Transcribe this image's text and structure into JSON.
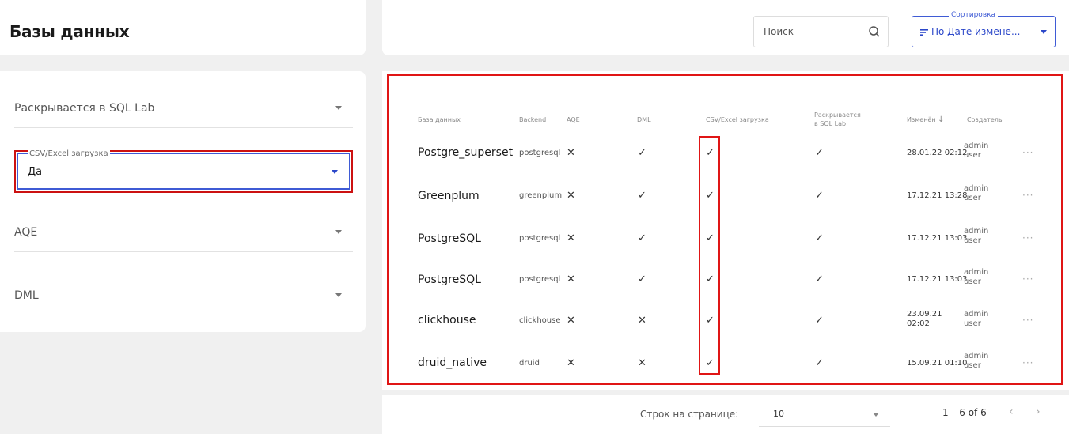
{
  "page": {
    "title": "Базы данных"
  },
  "filters": [
    {
      "label": "Раскрывается в SQL Lab"
    },
    {
      "label": "AQE"
    },
    {
      "label": "DML"
    }
  ],
  "active_filter": {
    "label": "CSV/Excel загрузка",
    "value": "Да"
  },
  "search": {
    "placeholder": "Поиск"
  },
  "sort": {
    "label": "Сортировка",
    "value": "По Дате измене..."
  },
  "table": {
    "headers": {
      "database": "База данных",
      "backend": "Backend",
      "aqe": "AQE",
      "dml": "DML",
      "csv": "CSV/Excel загрузка",
      "exposed": "Раскрывается в SQL Lab",
      "modified": "Изменён",
      "creator": "Создатель"
    },
    "rows": [
      {
        "name": "Postgre_superset",
        "backend": "postgresql",
        "aqe": "✕",
        "dml": "✓",
        "csv": "✓",
        "exposed": "✓",
        "modified": "28.01.22 02:12",
        "creator": "admin user"
      },
      {
        "name": "Greenplum",
        "backend": "greenplum",
        "aqe": "✕",
        "dml": "✓",
        "csv": "✓",
        "exposed": "✓",
        "modified": "17.12.21 13:28",
        "creator": "admin user"
      },
      {
        "name": "PostgreSQL",
        "backend": "postgresql",
        "aqe": "✕",
        "dml": "✓",
        "csv": "✓",
        "exposed": "✓",
        "modified": "17.12.21 13:03",
        "creator": "admin user"
      },
      {
        "name": "PostgreSQL",
        "backend": "postgresql",
        "aqe": "✕",
        "dml": "✓",
        "csv": "✓",
        "exposed": "✓",
        "modified": "17.12.21 13:03",
        "creator": "admin user"
      },
      {
        "name": "clickhouse",
        "backend": "clickhouse",
        "aqe": "✕",
        "dml": "✕",
        "csv": "✓",
        "exposed": "✓",
        "modified": "23.09.21 02:02",
        "creator": "admin user"
      },
      {
        "name": "druid_native",
        "backend": "druid",
        "aqe": "✕",
        "dml": "✕",
        "csv": "✓",
        "exposed": "✓",
        "modified": "15.09.21 01:10",
        "creator": "admin user"
      }
    ],
    "more_label": "···"
  },
  "pagination": {
    "rows_label": "Строк на странице:",
    "rows_value": "10",
    "range": "1 – 6 of 6",
    "prev": "‹",
    "next": "›"
  },
  "colors": {
    "accent": "#2b47c9",
    "highlight": "#e01515"
  }
}
